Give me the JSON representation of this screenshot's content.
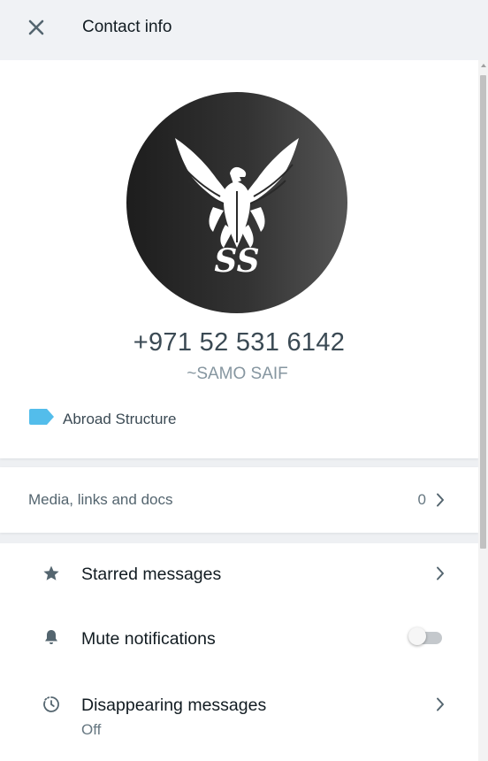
{
  "header": {
    "title": "Contact info",
    "close_icon": "close-icon"
  },
  "profile": {
    "avatar_initials": "SS",
    "phone": "+971 52 531 6142",
    "push_name": "~SAMO SAIF",
    "label": {
      "text": "Abroad Structure",
      "color": "#53bdeb"
    }
  },
  "media": {
    "title": "Media, links and docs",
    "count": "0"
  },
  "settings": {
    "starred": {
      "title": "Starred messages",
      "icon": "star-icon"
    },
    "mute": {
      "title": "Mute notifications",
      "icon": "bell-icon",
      "enabled": false
    },
    "disappearing": {
      "title": "Disappearing messages",
      "status": "Off",
      "icon": "timer-icon"
    }
  },
  "colors": {
    "header_bg": "#f0f2f5",
    "page_bg": "#eef0f3",
    "panel_bg": "#ffffff",
    "icon_gray": "#54656f",
    "label_blue": "#53bdeb"
  }
}
